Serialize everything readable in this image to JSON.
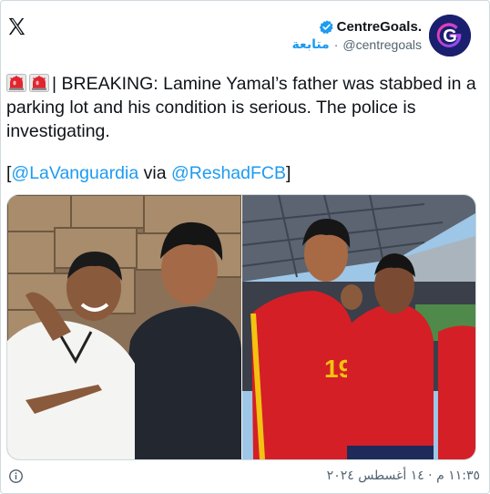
{
  "header": {
    "display_name": "CentreGoals.",
    "follow_label": "متابعة",
    "separator": "·",
    "handle": "@centregoals",
    "avatar_letter": "G"
  },
  "tweet": {
    "text_main": "| BREAKING: Lamine Yamal’s father was stabbed in a parking lot and his condition is serious. The police is investigating.",
    "source_open": "[",
    "source_link_1": "@LaVanguardia",
    "source_via": " via ",
    "source_link_2": "@ReshadFCB",
    "source_close": "]",
    "emoji": "police-light-icon"
  },
  "footer": {
    "timestamp": "١١:٣٥ م · ١٤ أغسطس ٢٠٢٤"
  },
  "colors": {
    "accent": "#1d9bf0",
    "text": "#0f1419",
    "muted": "#536471",
    "avatar_bg": "#1a1f6e"
  }
}
